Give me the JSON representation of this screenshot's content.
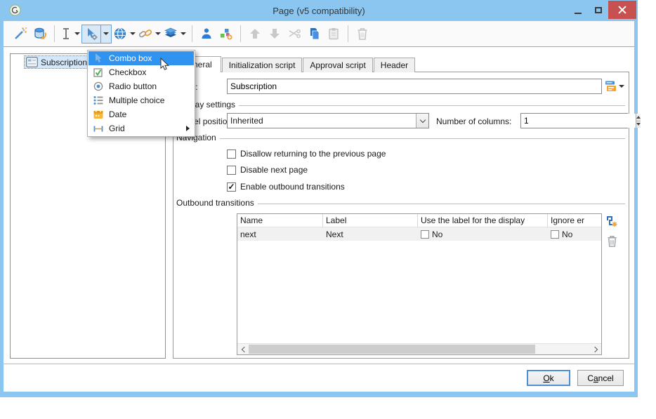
{
  "window": {
    "title": "Page (v5 compatibility)"
  },
  "toolbar": {
    "buttons": [
      "wizard",
      "database-import",
      "text-field",
      "form-control",
      "web-control",
      "link-control",
      "layers-control",
      "person",
      "group-add",
      "move-up",
      "move-down",
      "cut",
      "copy",
      "paste",
      "delete"
    ]
  },
  "tree": {
    "items": [
      {
        "label": "Subscription"
      }
    ]
  },
  "context_menu": {
    "items": [
      {
        "label": "Combo box",
        "icon": "cursor-icon",
        "highlighted": true
      },
      {
        "label": "Checkbox",
        "icon": "checkbox-icon"
      },
      {
        "label": "Radio button",
        "icon": "radio-icon"
      },
      {
        "label": "Multiple choice",
        "icon": "list-icon"
      },
      {
        "label": "Date",
        "icon": "calendar-icon"
      },
      {
        "label": "Grid",
        "icon": "grid-icon",
        "has_submenu": true
      }
    ]
  },
  "tabs": [
    {
      "label": "General",
      "active": true
    },
    {
      "label": "Initialization script"
    },
    {
      "label": "Approval script"
    },
    {
      "label": "Header"
    }
  ],
  "form": {
    "title": {
      "label": "Title:",
      "value": "Subscription"
    },
    "display_settings": {
      "label": "Display settings",
      "label_position": {
        "label": "Label position:",
        "value": "Inherited"
      },
      "number_of_columns": {
        "label": "Number of columns:",
        "value": "1"
      }
    },
    "navigation": {
      "label": "Navigation",
      "checkboxes": [
        {
          "label": "Disallow returning to the previous page",
          "checked": false,
          "glyph": ""
        },
        {
          "label": "Disable next page",
          "checked": false,
          "glyph": ""
        },
        {
          "label": "Enable outbound transitions",
          "checked": true,
          "glyph": "✓"
        }
      ]
    },
    "outbound_transitions": {
      "label": "Outbound transitions",
      "table": {
        "columns": [
          "Name",
          "Label",
          "Use the label for the display",
          "Ignore er"
        ],
        "rows": [
          {
            "name": "next",
            "label": "Next",
            "use_label_glyph": "",
            "use_label_text": "No",
            "ignore_glyph": "",
            "ignore_text": "No"
          }
        ]
      }
    }
  },
  "footer": {
    "ok": {
      "mnemonic": "O",
      "rest": "k"
    },
    "cancel": {
      "pre": "C",
      "mnemonic": "a",
      "rest": "ncel"
    }
  }
}
